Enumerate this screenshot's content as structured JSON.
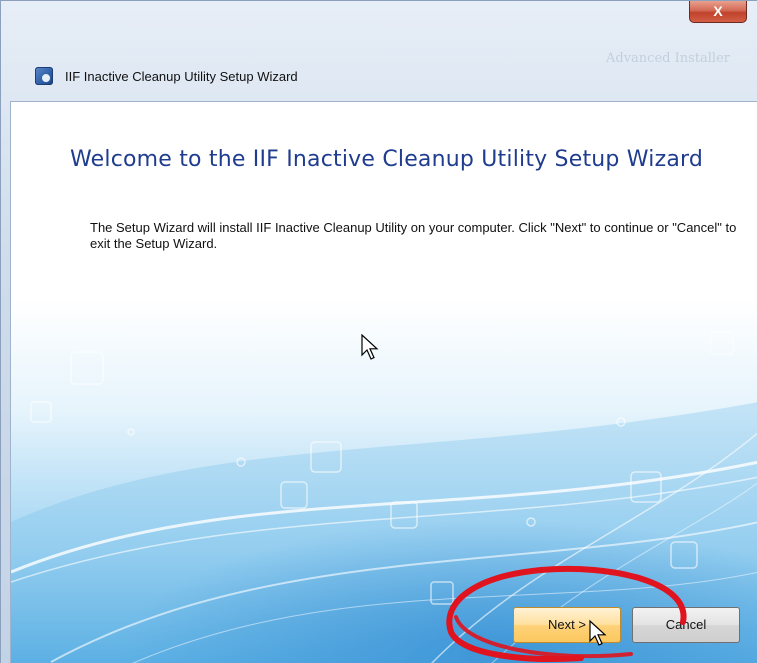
{
  "window": {
    "title": "IIF Inactive Cleanup Utility Setup Wizard",
    "brand": "Advanced Installer",
    "close_glyph": "X"
  },
  "content": {
    "heading": "Welcome to the IIF Inactive Cleanup Utility Setup Wizard",
    "body": "The Setup Wizard will install IIF Inactive Cleanup Utility on your computer.  Click \"Next\" to continue or \"Cancel\" to exit the Setup Wizard."
  },
  "buttons": {
    "next_label": "Next >",
    "cancel_label": "Cancel"
  },
  "icons": {
    "app": "installer-disc-icon",
    "close": "close-icon",
    "cursor": "mouse-pointer-icon"
  },
  "colors": {
    "heading": "#1f3c8f",
    "annotation": "#e0141e",
    "next_button": "#ffd27a"
  }
}
